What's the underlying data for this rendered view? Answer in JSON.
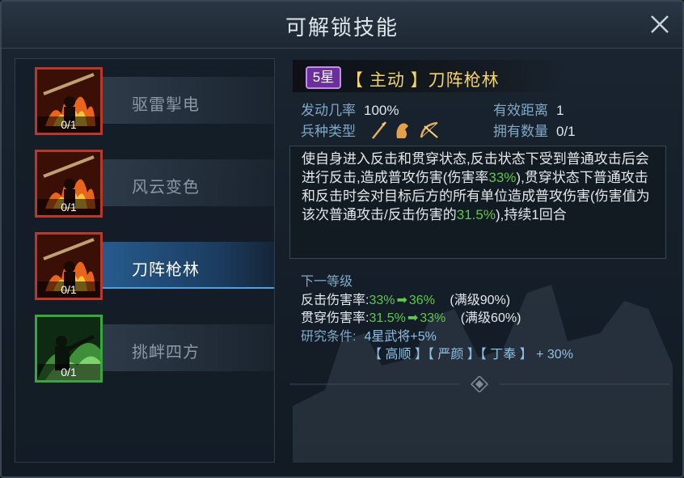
{
  "window": {
    "title": "可解锁技能",
    "close_icon": "close-icon"
  },
  "skills": [
    {
      "name": "驱雷掣电",
      "count": "0/1",
      "frame": "red",
      "active": false
    },
    {
      "name": "风云变色",
      "count": "0/1",
      "frame": "red",
      "active": false
    },
    {
      "name": "刀阵枪林",
      "count": "0/1",
      "frame": "red",
      "active": true
    },
    {
      "name": "挑衅四方",
      "count": "0/1",
      "frame": "green",
      "active": false
    }
  ],
  "detail": {
    "star_badge": "5星",
    "title": "【 主动 】刀阵枪林",
    "trigger_rate_label": "发动几率",
    "trigger_rate_value": "100%",
    "range_label": "有效距离",
    "range_value": "1",
    "unit_type_label": "兵种类型",
    "unit_type_icons": [
      "spear-icon",
      "horse-icon",
      "bow-icon"
    ],
    "owned_label": "拥有数量",
    "owned_value": "0/1",
    "description": {
      "p1": "使自身进入反击和贯穿状态,反击状态下受到普通攻击后会进行反击,造成普攻伤害(伤害率",
      "h1": "33%",
      "p2": "),贯穿状态下普通攻击和反击时会对目标后方的所有单位造成普攻伤害(伤害值为该次普通攻击/反击伤害的",
      "h2": "31.5%",
      "p3": "),持续1回合"
    },
    "next_level": {
      "title": "下一等级",
      "counter": {
        "label": "反击伤害率:",
        "from": "33%",
        "to": "36%",
        "max": "(满级90%)"
      },
      "pierce": {
        "label": "贯穿伤害率:",
        "from": "31.5%",
        "to": "33%",
        "max": "(满级60%)"
      }
    },
    "research": {
      "label": "研究条件:",
      "value": "4星武将+5%",
      "generals": "【 高顺 】【 严颜 】【 丁奉 】 + 30%"
    }
  },
  "colors": {
    "highlight_green": "#5fc74d",
    "title_gold": "#f3d36a",
    "active_blue": "#2860a0"
  }
}
